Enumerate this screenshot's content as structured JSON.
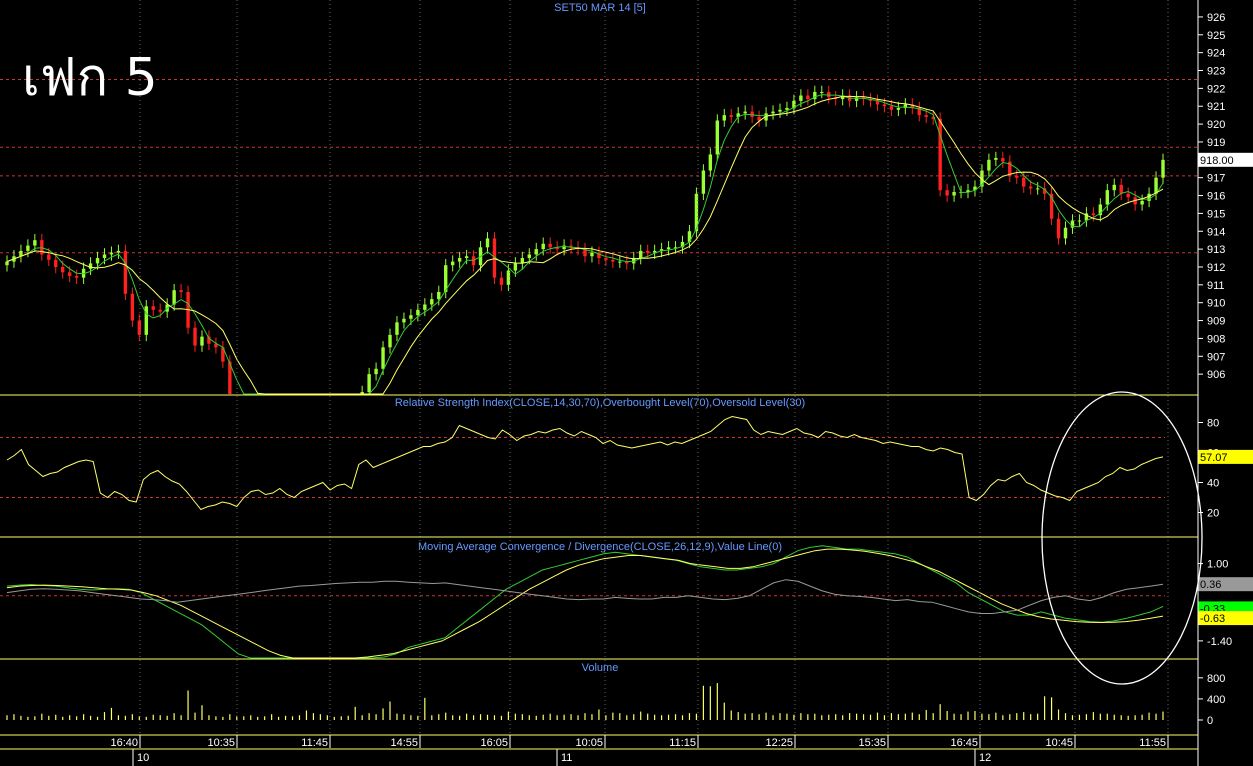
{
  "big_label": "เฟก 5",
  "colors": {
    "up_candle": "#99ff33",
    "down_candle": "#ff2020",
    "ma_fast": "#33cc33",
    "ma_slow": "#ffff66",
    "rsi_line": "#ffff66",
    "macd_line": "#33cc33",
    "signal_line": "#ffff66",
    "value_line": "#999999",
    "volume_bar": "#ffff66",
    "level_line": "#cc3333",
    "panel_border": "#ffff66",
    "title_text": "#6699ff",
    "axis_text": "#ffffff",
    "ellipse": "#ffffff"
  },
  "chart_data": [
    {
      "type": "candlestick",
      "title": "SET50 MAR 14   [5]",
      "ylim": [
        905,
        926.5
      ],
      "yticks": [
        "926",
        "925",
        "924",
        "923",
        "922",
        "921",
        "920",
        "919",
        "918",
        "917",
        "916",
        "915",
        "914",
        "913",
        "912",
        "911",
        "910",
        "909",
        "908",
        "907",
        "906"
      ],
      "level_lines": [
        922.5,
        918.7,
        917.1,
        912.8
      ],
      "last_price": "918.00",
      "last_price_value": 918.0,
      "close_series": [
        912.3,
        912.6,
        912.9,
        913.2,
        913.5,
        912.7,
        912.4,
        912.0,
        911.7,
        911.5,
        911.4,
        911.9,
        912.2,
        912.5,
        912.7,
        912.8,
        912.9,
        910.5,
        909.0,
        908.2,
        909.8,
        909.6,
        909.5,
        909.9,
        910.7,
        910.6,
        908.6,
        907.6,
        908.1,
        907.7,
        907.5,
        906.7,
        904.5,
        904.0,
        903.5,
        903.0,
        902.5,
        902.0,
        902.0,
        902.0,
        902.0,
        902.0,
        902.0,
        902.0,
        902.0,
        902.0,
        902.0,
        902.0,
        903.0,
        904.0,
        904.0,
        905.0,
        906.0,
        906.3,
        907.5,
        908.2,
        908.9,
        909.1,
        909.3,
        909.6,
        909.9,
        910.2,
        910.6,
        912.1,
        912.3,
        912.5,
        912.6,
        912.1,
        913.1,
        913.6,
        911.4,
        911.0,
        911.8,
        912.2,
        912.5,
        912.7,
        913.0,
        913.3,
        913.1,
        913.0,
        913.2,
        913.1,
        913.0,
        912.6,
        912.8,
        912.5,
        912.4,
        912.3,
        912.3,
        912.2,
        912.5,
        912.9,
        912.8,
        912.9,
        913.0,
        913.1,
        913.1,
        913.4,
        914.0,
        916.1,
        917.4,
        918.3,
        920.2,
        920.5,
        920.4,
        920.6,
        920.7,
        920.4,
        920.2,
        920.6,
        920.7,
        920.8,
        920.9,
        921.3,
        921.6,
        921.4,
        921.8,
        921.8,
        921.5,
        921.4,
        921.6,
        921.3,
        921.5,
        921.4,
        921.3,
        921.1,
        921.0,
        920.8,
        920.9,
        921.1,
        920.9,
        920.5,
        920.4,
        920.3,
        916.3,
        916.0,
        916.2,
        916.2,
        916.3,
        916.5,
        917.4,
        918.0,
        918.1,
        917.9,
        917.1,
        917.0,
        916.5,
        916.4,
        916.4,
        916.1,
        914.7,
        913.6,
        914.2,
        914.6,
        914.6,
        915.0,
        914.9,
        915.5,
        916.3,
        916.6,
        916.1,
        915.9,
        915.5,
        915.7,
        916.1,
        917.0,
        918.0
      ]
    },
    {
      "type": "line",
      "title": "Relative Strength Index(CLOSE,14,30,70),Overbought Level(70),Oversold Level(30)",
      "ylim": [
        5,
        95
      ],
      "yticks": [
        "80",
        "60",
        "40",
        "20"
      ],
      "level_lines": [
        70,
        30
      ],
      "last_value": "57.07",
      "last_value_num": 57.07,
      "values": [
        55,
        58,
        62,
        52,
        48,
        44,
        46,
        47,
        50,
        52,
        54,
        55,
        54,
        33,
        30,
        34,
        32,
        28,
        27,
        42,
        46,
        48,
        44,
        41,
        39,
        34,
        28,
        22,
        24,
        25,
        27,
        26,
        24,
        30,
        34,
        35,
        32,
        33,
        36,
        32,
        30,
        34,
        36,
        38,
        40,
        35,
        38,
        39,
        36,
        52,
        55,
        50,
        52,
        54,
        56,
        58,
        60,
        62,
        64,
        64,
        66,
        67,
        70,
        78,
        76,
        74,
        72,
        70,
        69,
        75,
        72,
        68,
        71,
        72,
        74,
        73,
        75,
        76,
        73,
        71,
        74,
        72,
        70,
        66,
        68,
        65,
        64,
        63,
        64,
        65,
        66,
        67,
        65,
        67,
        66,
        68,
        70,
        72,
        74,
        78,
        82,
        84,
        83,
        82,
        75,
        72,
        74,
        73,
        72,
        74,
        76,
        73,
        72,
        70,
        74,
        73,
        71,
        70,
        72,
        70,
        69,
        68,
        66,
        67,
        66,
        65,
        64,
        64,
        62,
        61,
        63,
        62,
        60,
        59,
        30,
        28,
        32,
        38,
        42,
        41,
        44,
        46,
        40,
        38,
        35,
        33,
        31,
        30,
        28,
        34,
        36,
        38,
        40,
        44,
        46,
        50,
        48,
        49,
        52,
        54,
        56,
        57.07
      ]
    },
    {
      "type": "line",
      "title": "Moving Average Convergence / Divergence(CLOSE,26,12,9),Value Line(0)",
      "ylim": [
        -1.9,
        1.7
      ],
      "yticks": [
        "1.00",
        "0.40",
        "-1.40"
      ],
      "level_lines": [
        0
      ],
      "last_values": [
        "0.36",
        "-0.33",
        "-0.63"
      ],
      "series": [
        {
          "values": [
            0.3,
            0.33,
            0.35,
            0.32,
            0.3,
            0.25,
            0.2,
            0.18,
            0.2,
            0.22,
            0.2,
            0.1,
            -0.1,
            -0.3,
            -0.5,
            -0.7,
            -0.9,
            -1.2,
            -1.5,
            -1.8,
            -2.0,
            -2.0,
            -2.0,
            -2.0,
            -2.0,
            -2.0,
            -2.0,
            -2.0,
            -2.0,
            -2.0,
            -2.0,
            -1.9,
            -1.8,
            -1.6,
            -1.5,
            -1.4,
            -1.3,
            -1.0,
            -0.7,
            -0.4,
            -0.1,
            0.2,
            0.4,
            0.6,
            0.8,
            0.9,
            1.0,
            1.1,
            1.2,
            1.3,
            1.35,
            1.3,
            1.25,
            1.2,
            1.15,
            1.1,
            1.0,
            0.9,
            0.85,
            0.8,
            0.8,
            0.85,
            0.9,
            1.0,
            1.2,
            1.4,
            1.5,
            1.55,
            1.5,
            1.45,
            1.45,
            1.4,
            1.35,
            1.3,
            1.2,
            1.0,
            0.8,
            0.6,
            0.4,
            0.1,
            -0.1,
            -0.3,
            -0.5,
            -0.6,
            -0.6,
            -0.5,
            -0.6,
            -0.7,
            -0.75,
            -0.8,
            -0.82,
            -0.78,
            -0.7,
            -0.6,
            -0.5,
            -0.33
          ]
        },
        {
          "values": [
            0.25,
            0.3,
            0.32,
            0.33,
            0.32,
            0.3,
            0.28,
            0.25,
            0.22,
            0.2,
            0.18,
            0.1,
            0.0,
            -0.15,
            -0.3,
            -0.5,
            -0.7,
            -0.9,
            -1.1,
            -1.3,
            -1.5,
            -1.7,
            -1.85,
            -1.95,
            -2.0,
            -2.0,
            -2.0,
            -2.0,
            -1.95,
            -1.9,
            -1.85,
            -1.8,
            -1.7,
            -1.6,
            -1.5,
            -1.4,
            -1.2,
            -1.0,
            -0.8,
            -0.55,
            -0.3,
            -0.05,
            0.2,
            0.4,
            0.6,
            0.8,
            0.95,
            1.05,
            1.15,
            1.2,
            1.25,
            1.25,
            1.2,
            1.15,
            1.1,
            1.0,
            0.95,
            0.9,
            0.85,
            0.85,
            0.9,
            1.0,
            1.1,
            1.2,
            1.3,
            1.4,
            1.45,
            1.45,
            1.42,
            1.38,
            1.32,
            1.25,
            1.15,
            1.05,
            0.9,
            0.75,
            0.55,
            0.35,
            0.15,
            -0.05,
            -0.25,
            -0.4,
            -0.55,
            -0.65,
            -0.72,
            -0.76,
            -0.8,
            -0.82,
            -0.83,
            -0.82,
            -0.8,
            -0.76,
            -0.7,
            -0.63
          ]
        },
        {
          "values": [
            0.1,
            0.15,
            0.2,
            0.22,
            0.2,
            0.18,
            0.15,
            0.1,
            0.05,
            0.0,
            -0.05,
            -0.1,
            -0.12,
            -0.15,
            -0.2,
            -0.15,
            -0.1,
            -0.05,
            0.0,
            0.05,
            0.1,
            0.15,
            0.2,
            0.25,
            0.3,
            0.32,
            0.35,
            0.38,
            0.4,
            0.42,
            0.42,
            0.45,
            0.45,
            0.42,
            0.4,
            0.38,
            0.4,
            0.35,
            0.3,
            0.25,
            0.2,
            0.15,
            0.1,
            0.05,
            0.0,
            -0.05,
            -0.1,
            -0.12,
            -0.1,
            -0.1,
            -0.05,
            -0.08,
            -0.1,
            -0.1,
            -0.05,
            -0.05,
            0.0,
            -0.05,
            -0.1,
            -0.12,
            -0.08,
            0.0,
            0.2,
            0.4,
            0.5,
            0.45,
            0.3,
            0.15,
            0.05,
            0.0,
            -0.02,
            -0.05,
            -0.1,
            -0.15,
            -0.12,
            -0.18,
            -0.2,
            -0.3,
            -0.4,
            -0.5,
            -0.55,
            -0.55,
            -0.5,
            -0.45,
            -0.3,
            -0.15,
            -0.05,
            0.0,
            -0.1,
            -0.15,
            -0.05,
            0.1,
            0.2,
            0.25,
            0.3,
            0.36
          ]
        }
      ]
    },
    {
      "type": "bar",
      "title": "Volume",
      "ylim": [
        0,
        1100
      ],
      "yticks": [
        "800",
        "400",
        "0"
      ],
      "values": [
        90,
        110,
        80,
        60,
        70,
        120,
        80,
        100,
        60,
        90,
        70,
        110,
        80,
        60,
        150,
        230,
        90,
        80,
        110,
        70,
        60,
        100,
        90,
        80,
        130,
        90,
        560,
        140,
        280,
        90,
        70,
        60,
        110,
        80,
        70,
        90,
        60,
        70,
        110,
        60,
        80,
        70,
        90,
        180,
        130,
        110,
        90,
        60,
        70,
        80,
        250,
        90,
        130,
        110,
        220,
        350,
        120,
        110,
        90,
        80,
        420,
        90,
        110,
        140,
        90,
        80,
        120,
        90,
        110,
        100,
        90,
        80,
        160,
        120,
        110,
        90,
        80,
        100,
        120,
        90,
        100,
        110,
        90,
        130,
        110,
        200,
        90,
        140,
        130,
        90,
        110,
        160,
        120,
        100,
        90,
        100,
        110,
        90,
        130,
        120,
        650,
        640,
        700,
        330,
        180,
        150,
        120,
        130,
        110,
        140,
        90,
        130,
        120,
        100,
        130,
        110,
        120,
        90,
        100,
        110,
        90,
        130,
        120,
        110,
        100,
        140,
        90,
        130,
        110,
        120,
        140,
        110,
        190,
        130,
        300,
        170,
        120,
        110,
        160,
        170,
        120,
        110,
        140,
        90,
        110,
        130,
        150,
        110,
        120,
        450,
        430,
        200,
        130,
        90,
        100,
        110,
        150,
        120,
        120,
        100,
        90,
        80,
        90,
        100,
        140,
        120,
        160
      ]
    },
    {
      "type": "axis",
      "xtick_labels": [
        "16:40",
        "10:35",
        "11:45",
        "14:55",
        "16:05",
        "10:05",
        "11:15",
        "12:25",
        "15:35",
        "16:45",
        "10:45",
        "11:55"
      ],
      "date_labels": [
        "10",
        "11",
        "12"
      ]
    }
  ]
}
